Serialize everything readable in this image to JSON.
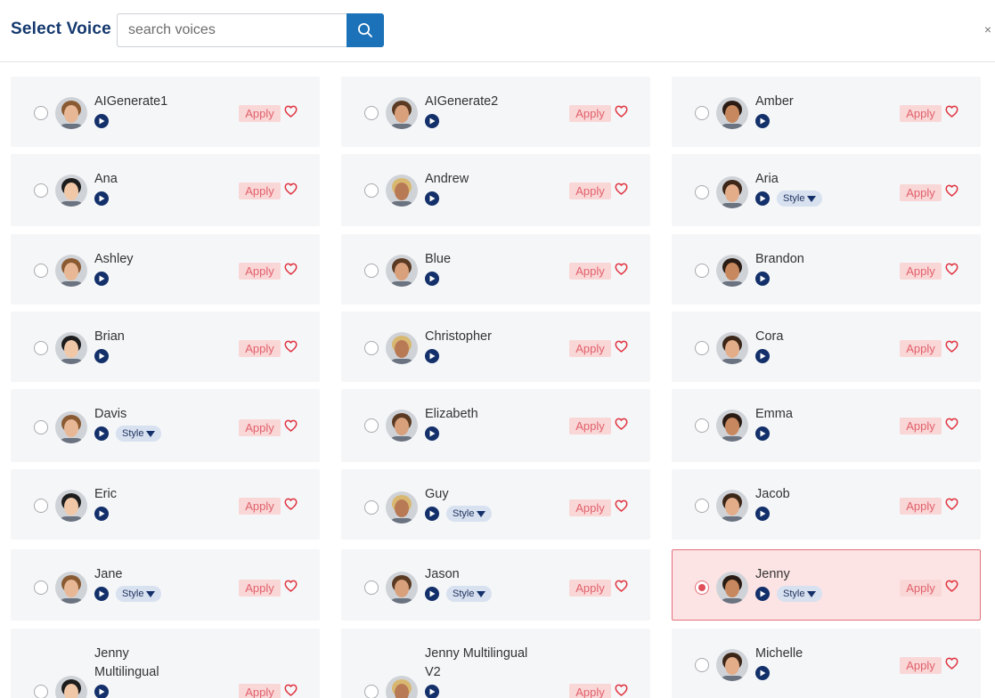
{
  "header": {
    "title": "Select Voice",
    "search_placeholder": "search voices",
    "search_icon": "search-icon",
    "close_icon": "close-icon",
    "close_glyph": "×"
  },
  "colors": {
    "title": "#14386e",
    "search_button": "#1c72b8",
    "card_bg": "#f5f6f8",
    "selected_bg": "#fde4e4",
    "selected_border": "#e3707b",
    "apply_bg": "#fad7d7",
    "apply_text": "#e0606b",
    "play": "#13306a",
    "heart": "#e0333f"
  },
  "apply_label": "Apply",
  "style_label": "Style",
  "voices": [
    {
      "name": "AIGenerate1",
      "has_style": false,
      "selected": false
    },
    {
      "name": "AIGenerate2",
      "has_style": false,
      "selected": false
    },
    {
      "name": "Amber",
      "has_style": false,
      "selected": false
    },
    {
      "name": "Ana",
      "has_style": false,
      "selected": false
    },
    {
      "name": "Andrew",
      "has_style": false,
      "selected": false
    },
    {
      "name": "Aria",
      "has_style": true,
      "selected": false
    },
    {
      "name": "Ashley",
      "has_style": false,
      "selected": false
    },
    {
      "name": "Blue",
      "has_style": false,
      "selected": false
    },
    {
      "name": "Brandon",
      "has_style": false,
      "selected": false
    },
    {
      "name": "Brian",
      "has_style": false,
      "selected": false
    },
    {
      "name": "Christopher",
      "has_style": false,
      "selected": false
    },
    {
      "name": "Cora",
      "has_style": false,
      "selected": false
    },
    {
      "name": "Davis",
      "has_style": true,
      "selected": false
    },
    {
      "name": "Elizabeth",
      "has_style": false,
      "selected": false
    },
    {
      "name": "Emma",
      "has_style": false,
      "selected": false
    },
    {
      "name": "Eric",
      "has_style": false,
      "selected": false
    },
    {
      "name": "Guy",
      "has_style": true,
      "selected": false
    },
    {
      "name": "Jacob",
      "has_style": false,
      "selected": false
    },
    {
      "name": "Jane",
      "has_style": true,
      "selected": false
    },
    {
      "name": "Jason",
      "has_style": true,
      "selected": false
    },
    {
      "name": "Jenny",
      "has_style": true,
      "selected": true
    },
    {
      "name": "Jenny Multilingual",
      "has_style": false,
      "selected": false
    },
    {
      "name": "Jenny Multilingual V2",
      "has_style": false,
      "selected": false
    },
    {
      "name": "Michelle",
      "has_style": false,
      "selected": false
    }
  ]
}
